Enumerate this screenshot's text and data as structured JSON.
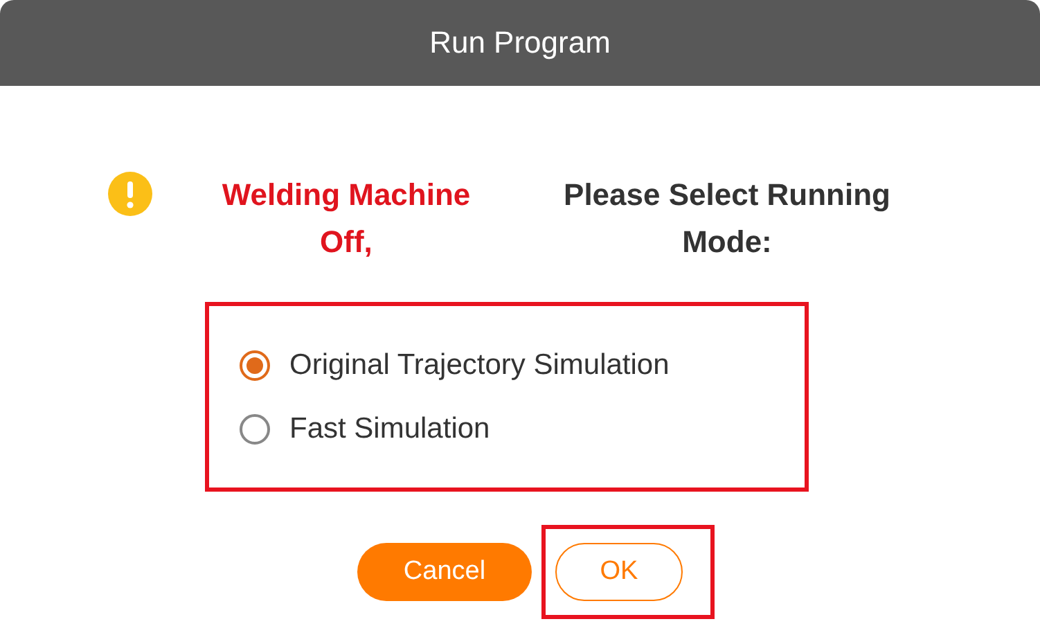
{
  "window": {
    "title": "Run Program"
  },
  "message": {
    "warning": "Welding Machine Off,",
    "prompt": "Please Select Running Mode:"
  },
  "modes": [
    {
      "label": "Original Trajectory Simulation",
      "selected": true
    },
    {
      "label": "Fast Simulation",
      "selected": false
    }
  ],
  "buttons": [
    {
      "label": "Cancel",
      "kind": "primary"
    },
    {
      "label": "OK",
      "kind": "secondary"
    }
  ]
}
